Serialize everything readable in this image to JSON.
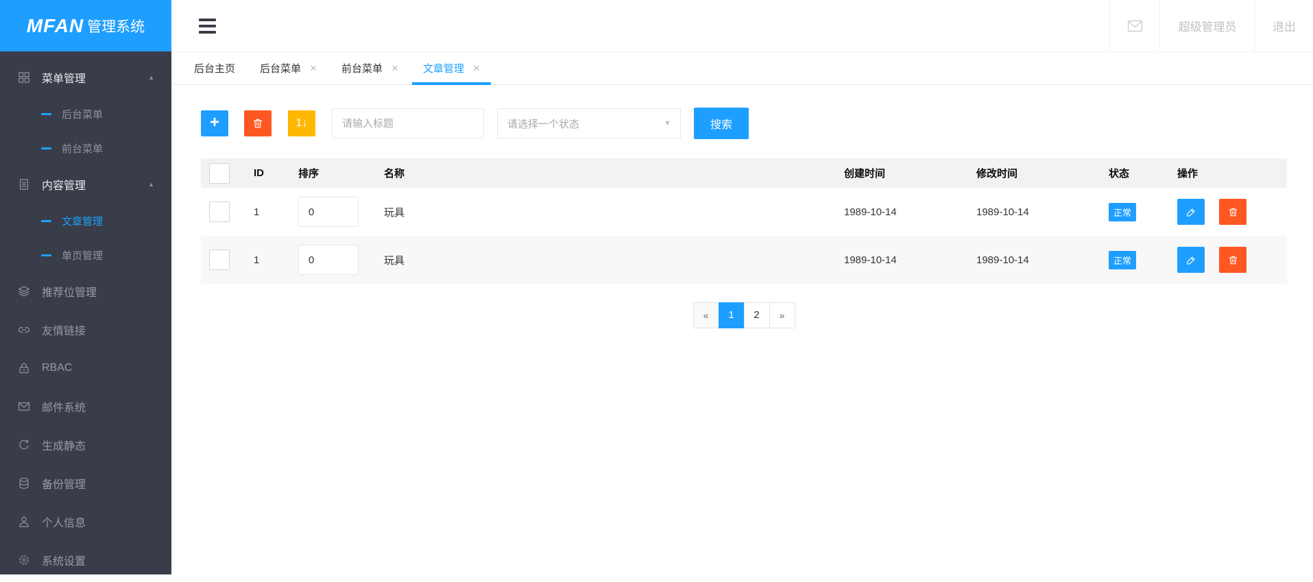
{
  "brand": {
    "name_bold": "MFAN",
    "name_light": "管理系统"
  },
  "topbar": {
    "username": "超级管理员",
    "logout": "退出"
  },
  "sidebar": {
    "collapse_glyph": "▲",
    "groups": [
      {
        "label": "菜单管理",
        "icon": "grid-icon",
        "expanded": true,
        "children": [
          {
            "label": "后台菜单",
            "active": false
          },
          {
            "label": "前台菜单",
            "active": false
          }
        ]
      },
      {
        "label": "内容管理",
        "icon": "document-icon",
        "expanded": true,
        "children": [
          {
            "label": "文章管理",
            "active": true
          },
          {
            "label": "单页管理",
            "active": false
          }
        ]
      },
      {
        "label": "推荐位管理",
        "icon": "layers-icon"
      },
      {
        "label": "友情链接",
        "icon": "link-icon"
      },
      {
        "label": "RBAC",
        "icon": "lock-icon"
      },
      {
        "label": "邮件系统",
        "icon": "mail-icon"
      },
      {
        "label": "生成静态",
        "icon": "refresh-icon"
      },
      {
        "label": "备份管理",
        "icon": "database-icon"
      },
      {
        "label": "个人信息",
        "icon": "user-icon"
      },
      {
        "label": "系统设置",
        "icon": "gear-icon"
      }
    ]
  },
  "tabbar": {
    "close_glyph": "×",
    "tabs": [
      {
        "label": "后台主页",
        "closable": false,
        "active": false
      },
      {
        "label": "后台菜单",
        "closable": true,
        "active": false
      },
      {
        "label": "前台菜单",
        "closable": true,
        "active": false
      },
      {
        "label": "文章管理",
        "closable": true,
        "active": true
      }
    ]
  },
  "toolbar": {
    "add_label": "+",
    "sort_label": "1↓",
    "title_placeholder": "请输入标题",
    "status_placeholder": "请选择一个状态",
    "select_caret": "▼",
    "search_label": "搜索"
  },
  "table": {
    "columns": [
      "ID",
      "排序",
      "名称",
      "创建时间",
      "修改时间",
      "状态",
      "操作"
    ],
    "rows": [
      {
        "id": "1",
        "sort": "0",
        "name": "玩具",
        "created": "1989-10-14",
        "modified": "1989-10-14",
        "status": "正常"
      },
      {
        "id": "1",
        "sort": "0",
        "name": "玩具",
        "created": "1989-10-14",
        "modified": "1989-10-14",
        "status": "正常"
      }
    ]
  },
  "pagination": {
    "prev": "«",
    "page1": "1",
    "page2": "2",
    "next": "»",
    "active_page": "1"
  },
  "colors": {
    "accent": "#1E9FFF",
    "danger": "#FF5722",
    "warning": "#FFB800",
    "sidebar_bg": "#393D49",
    "logo_bg": "#1E9FFF"
  }
}
